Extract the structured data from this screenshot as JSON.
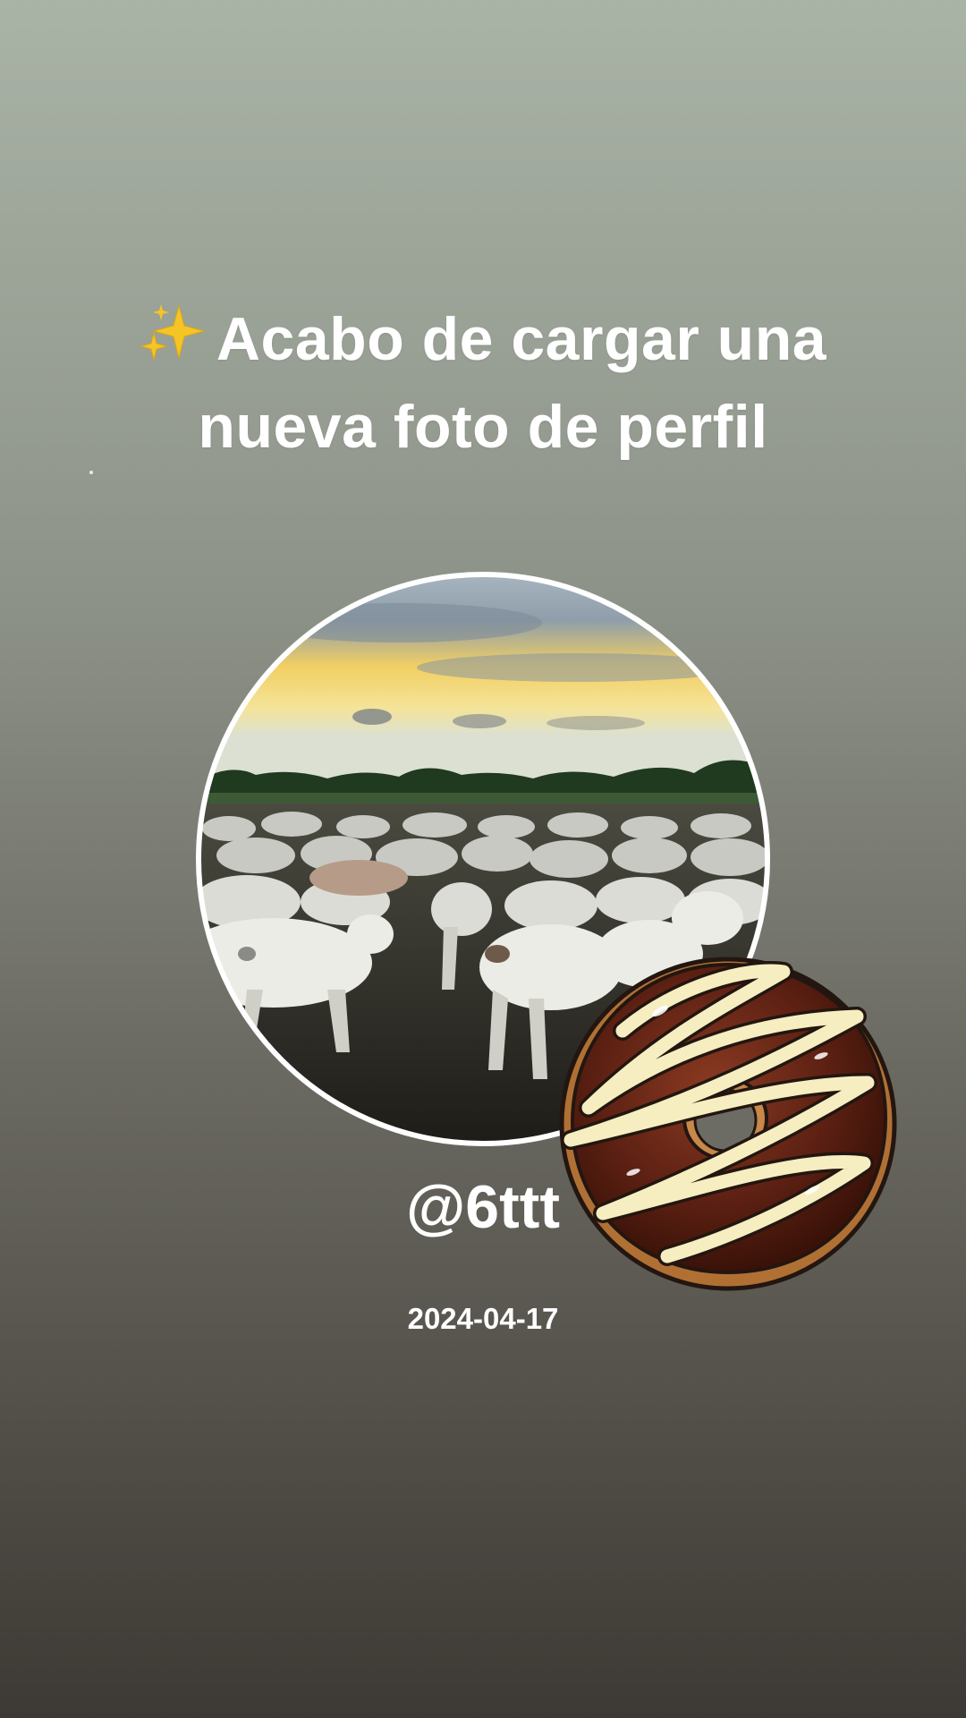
{
  "story": {
    "headline_line1": "Acabo de cargar una",
    "headline_line2": "nueva foto de perfil",
    "headline_emoji": "sparkles-icon",
    "username": "@6ttt",
    "date": "2024-04-17"
  },
  "stickers": [
    {
      "name": "chocolate-donut-sticker"
    }
  ],
  "colors": {
    "bg_top": "#a8b2a5",
    "bg_mid": "#6f6f67",
    "bg_bottom": "#3e3a35",
    "text": "#ffffff",
    "sparkle": "#f5c425",
    "donut_glaze": "#5a1f10",
    "donut_drizzle": "#f6eec0"
  }
}
